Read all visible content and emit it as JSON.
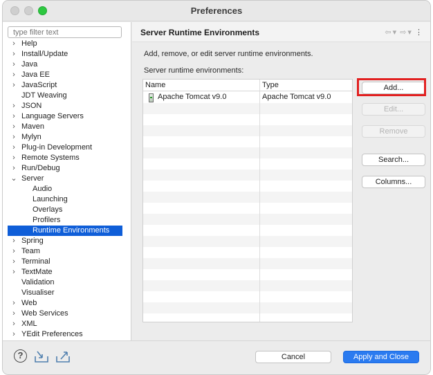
{
  "window": {
    "title": "Preferences"
  },
  "sidebar": {
    "filter_placeholder": "type filter text",
    "items": [
      {
        "label": "Help",
        "arrow": "›"
      },
      {
        "label": "Install/Update",
        "arrow": "›"
      },
      {
        "label": "Java",
        "arrow": "›"
      },
      {
        "label": "Java EE",
        "arrow": "›"
      },
      {
        "label": "JavaScript",
        "arrow": "›"
      },
      {
        "label": "JDT Weaving",
        "arrow": ""
      },
      {
        "label": "JSON",
        "arrow": "›"
      },
      {
        "label": "Language Servers",
        "arrow": "›"
      },
      {
        "label": "Maven",
        "arrow": "›"
      },
      {
        "label": "Mylyn",
        "arrow": "›"
      },
      {
        "label": "Plug-in Development",
        "arrow": "›"
      },
      {
        "label": "Remote Systems",
        "arrow": "›"
      },
      {
        "label": "Run/Debug",
        "arrow": "›"
      },
      {
        "label": "Server",
        "arrow": "⌄"
      },
      {
        "label": "Audio",
        "arrow": ""
      },
      {
        "label": "Launching",
        "arrow": ""
      },
      {
        "label": "Overlays",
        "arrow": ""
      },
      {
        "label": "Profilers",
        "arrow": ""
      },
      {
        "label": "Runtime Environments",
        "arrow": ""
      },
      {
        "label": "Spring",
        "arrow": "›"
      },
      {
        "label": "Team",
        "arrow": "›"
      },
      {
        "label": "Terminal",
        "arrow": "›"
      },
      {
        "label": "TextMate",
        "arrow": "›"
      },
      {
        "label": "Validation",
        "arrow": ""
      },
      {
        "label": "Visualiser",
        "arrow": ""
      },
      {
        "label": "Web",
        "arrow": "›"
      },
      {
        "label": "Web Services",
        "arrow": "›"
      },
      {
        "label": "XML",
        "arrow": "›"
      },
      {
        "label": "YEdit Preferences",
        "arrow": "›"
      }
    ]
  },
  "main": {
    "title": "Server Runtime Environments",
    "nav_back": "⇦",
    "nav_dropdown": "▾",
    "nav_forward": "⇨",
    "nav_menu": "⋮",
    "description": "Add, remove, or edit server runtime environments.",
    "list_label": "Server runtime environments:",
    "table": {
      "columns": [
        "Name",
        "Type"
      ],
      "rows": [
        {
          "name": "Apache Tomcat v9.0",
          "type": "Apache Tomcat v9.0"
        }
      ]
    },
    "buttons": {
      "add": "Add...",
      "edit": "Edit...",
      "remove": "Remove",
      "search": "Search...",
      "columns": "Columns..."
    }
  },
  "footer": {
    "help_glyph": "?",
    "cancel": "Cancel",
    "apply_close": "Apply and Close"
  },
  "colors": {
    "selection": "#0f5ed8",
    "primary_button": "#2b7bf0",
    "highlight_box": "#e22020"
  }
}
